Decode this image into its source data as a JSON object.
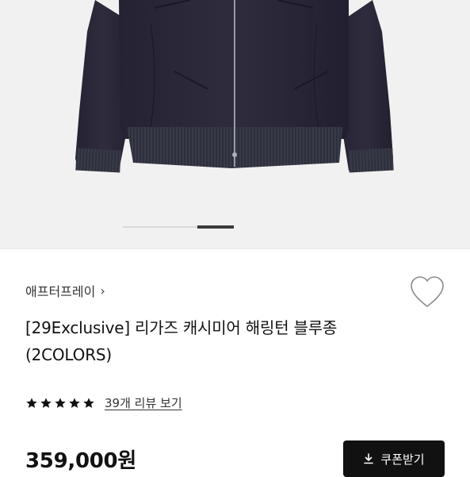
{
  "product": {
    "brand": "애프터프레이",
    "brand_chevron": "›",
    "title": "[29Exclusive] 리가즈 캐시미어 해링턴 블루종(2COLORS)",
    "rating_stars": 5,
    "review_link": "39개 리뷰 보기",
    "price": "359,000원",
    "coupon_button": "쿠폰받기"
  },
  "gallery": {
    "image": "navy-cashmere-harrington-jacket",
    "active_index": 3,
    "slide_count": 3
  },
  "colors": {
    "jacket": "#2d2b3a",
    "button_bg": "#111111",
    "star": "#111111",
    "background": "#f1f1f1"
  },
  "icons": {
    "wishlist": "heart-outline-icon",
    "coupon": "download-icon",
    "star": "star-icon",
    "chevron": "chevron-right-icon"
  }
}
